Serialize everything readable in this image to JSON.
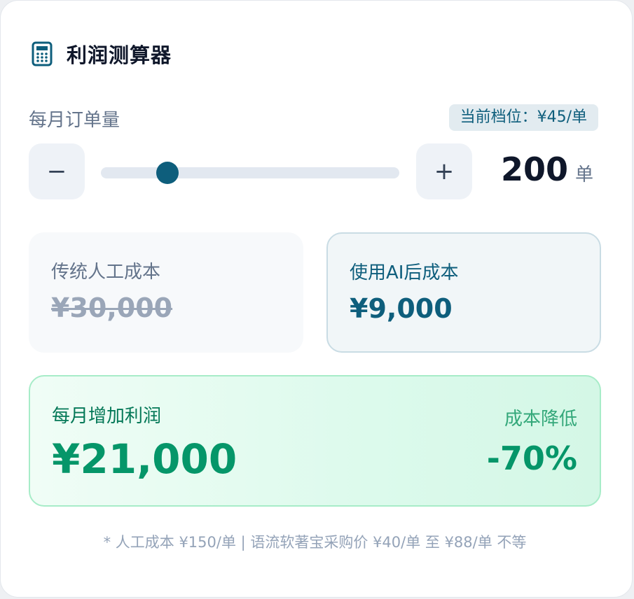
{
  "header": {
    "title": "利润测算器",
    "icon": "calculator-icon"
  },
  "orders": {
    "label": "每月订单量",
    "tier_badge": "当前档位：¥45/单",
    "decrement_label": "−",
    "increment_label": "+",
    "value": "200",
    "unit": "单",
    "slider_level": 0.2
  },
  "costs": {
    "manual": {
      "label": "传统人工成本",
      "value": "¥30,000"
    },
    "ai": {
      "label": "使用AI后成本",
      "value": "¥9,000"
    }
  },
  "profit": {
    "label": "每月增加利润",
    "value": "¥21,000",
    "reduction_label": "成本降低",
    "reduction_value": "-70%"
  },
  "footnote": "* 人工成本 ¥150/单 | 语流软著宝采购价 ¥40/单 至 ¥88/单 不等",
  "colors": {
    "accent": "#0e5e7c",
    "profit_green": "#059669",
    "muted": "#64748b"
  }
}
